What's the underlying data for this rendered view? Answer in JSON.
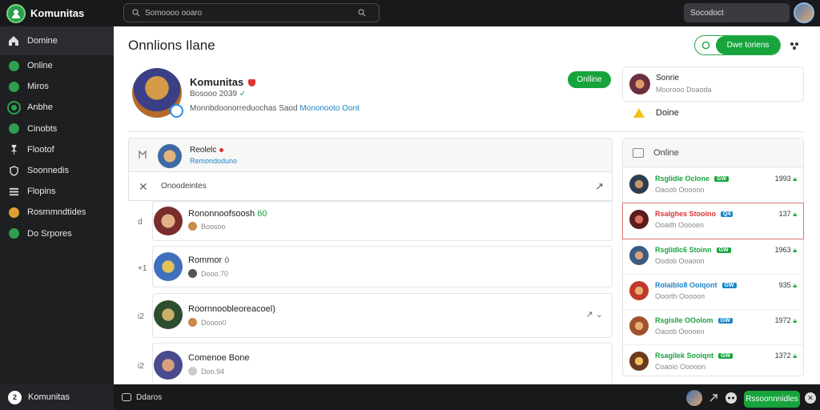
{
  "app": {
    "title": "Komunitas"
  },
  "search": {
    "placeholder": "Somoooo ooaro"
  },
  "topbar": {
    "secondary_search": "Socodoct"
  },
  "sidebar": {
    "items": [
      {
        "label": "Domine",
        "icon": "home-icon"
      },
      {
        "label": "Online",
        "icon": "people-icon"
      },
      {
        "label": "Miros",
        "icon": "compass-icon"
      },
      {
        "label": "Anbhe",
        "icon": "circle-icon"
      },
      {
        "label": "Cinobts",
        "icon": "chat-icon"
      },
      {
        "label": "Flootof",
        "icon": "pin-icon"
      },
      {
        "label": "Soonnedis",
        "icon": "shield-icon"
      },
      {
        "label": "Flopins",
        "icon": "list-icon"
      },
      {
        "label": "Rosmmndtides",
        "icon": "coin-icon"
      },
      {
        "label": "Do Srpores",
        "icon": "globe-icon"
      }
    ]
  },
  "main": {
    "title": "Onnlions Ilane",
    "header_button": "Dwe toriens"
  },
  "profile": {
    "name": "Komunitas",
    "sub": "Bosooo 2039",
    "sub_status": "✓",
    "desc": "Monnbdoonorreduochas Saod",
    "desc_link": "Mononooto Oont",
    "online_button": "Onlline"
  },
  "right_top": {
    "name": "Sonrie",
    "sub": "Moorooo Doaoda",
    "warning": "Doine"
  },
  "feed": {
    "head_name": "Reolelc",
    "head_sub": "Remondoduno",
    "bar_title": "Onoodeintes",
    "rows": [
      {
        "num": "d",
        "name": "Rononnoofsoosh",
        "badge": "60",
        "meta": "Boosoo"
      },
      {
        "num": "+1",
        "name": "Rommor",
        "badge": "ò",
        "meta": "Dooo.70"
      },
      {
        "num": "i2",
        "name": "Roornnoobleoreacoel)",
        "badge": "",
        "meta": "Doooo0"
      },
      {
        "num": "i2",
        "name": "Comenoe Bone",
        "badge": "",
        "meta": "Doo.94"
      }
    ]
  },
  "online_panel": {
    "title": "Online",
    "items": [
      {
        "name": "Rsglidle Oclone",
        "tag": "GW",
        "tag_color": "#17a43c",
        "color": "#17a43c",
        "sub": "Oaoob Ooooon",
        "value": "1993"
      },
      {
        "name": "Rsalghes Stooino",
        "tag": "Q4",
        "tag_color": "#1a86c9",
        "color": "#d33",
        "sub": "Ooaith Ooooen",
        "value": "137"
      },
      {
        "name": "Rsglidlc6 Stoinn",
        "tag": "GW",
        "tag_color": "#17a43c",
        "color": "#17a43c",
        "sub": "Oodob Ooaoon",
        "value": "1963"
      },
      {
        "name": "Rolaiblo8 Ooiqont",
        "tag": "GW",
        "tag_color": "#1a86c9",
        "color": "#1a86c9",
        "sub": "Ooorth Ooooon",
        "value": "935"
      },
      {
        "name": "Rsgislle OOolom",
        "tag": "GW",
        "tag_color": "#1a86c9",
        "color": "#17a43c",
        "sub": "Oaoob Ooooen",
        "value": "1972"
      },
      {
        "name": "Rsagilek Sooiqnt",
        "tag": "GW",
        "tag_color": "#17a43c",
        "color": "#17a43c",
        "sub": "Coaoio Ooooon",
        "value": "1372"
      }
    ]
  },
  "bottombar": {
    "user_initial": "2",
    "user": "Komunitas",
    "games": "Ddaros",
    "button": "Rssoonnnidles",
    "close": "✕"
  }
}
